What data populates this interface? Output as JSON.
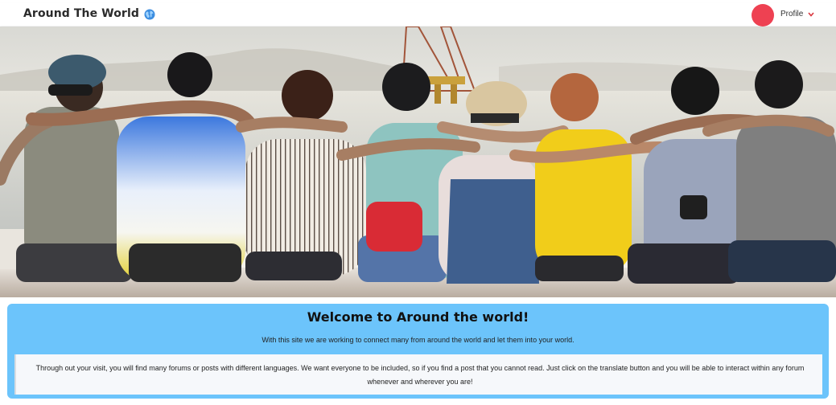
{
  "nav": {
    "brand": "Around The World",
    "globe_icon": "globe-icon",
    "profile_label": "Profile",
    "avatar_color": "#ee4152",
    "chevron_icon": "chevron-down-icon"
  },
  "hero": {
    "description_icon": "group-photo"
  },
  "welcome": {
    "title": "Welcome to Around the world!",
    "subtitle": "With this site we are working to connect many from around the world and let them into your world.",
    "body": "Through out your visit, you will find many forums or posts with different languages. We want everyone to be included, so if you find a post that you cannot read. Just click on the translate button and you will be able to interact within any forum whenever and wherever you are!",
    "card_color": "#6cc4fb"
  }
}
